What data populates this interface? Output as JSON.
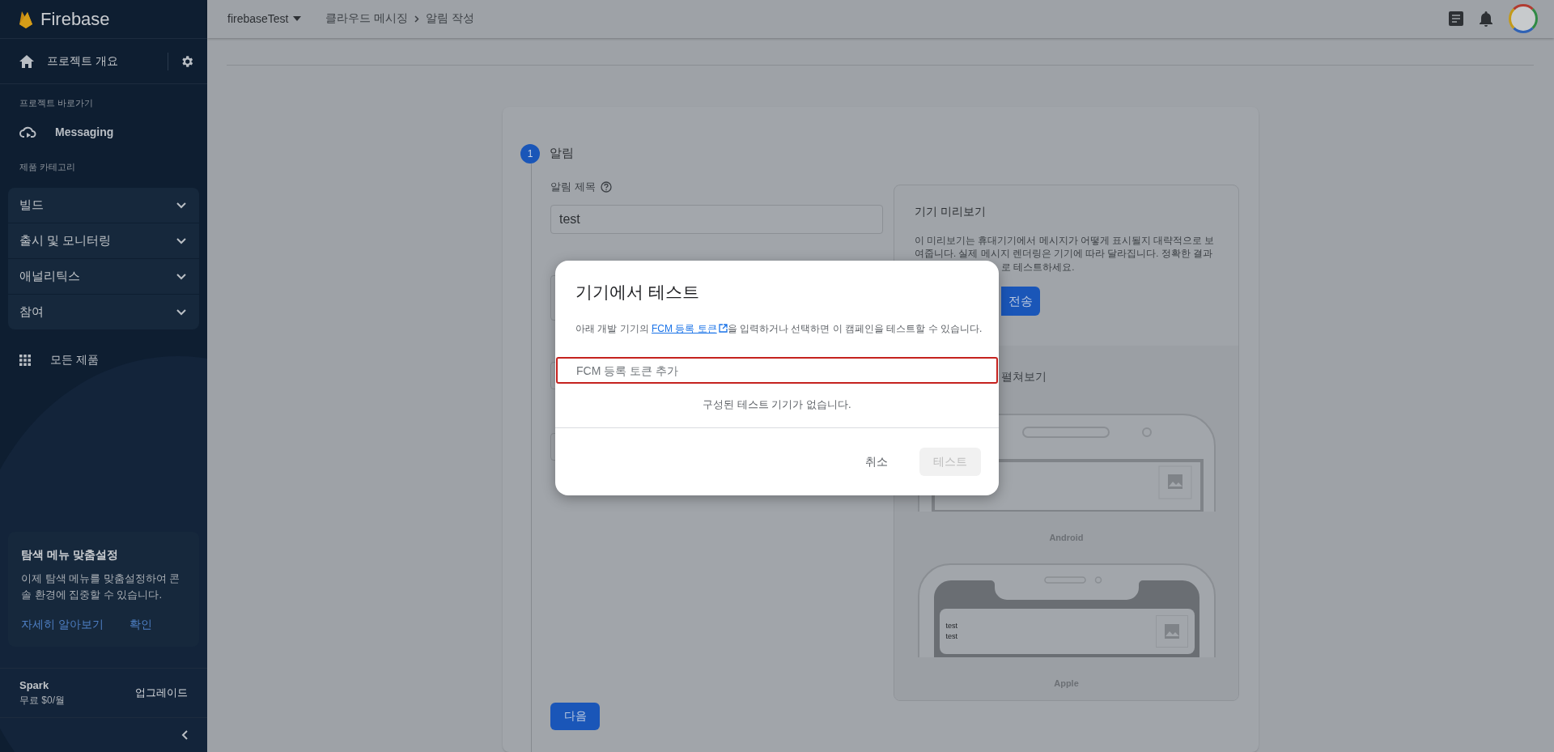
{
  "sidebar": {
    "brand": "Firebase",
    "project_overview": "프로젝트 개요",
    "shortcuts_label": "프로젝트 바로가기",
    "shortcuts": [
      {
        "label": "Messaging"
      }
    ],
    "categories_label": "제품 카테고리",
    "categories": [
      {
        "label": "빌드",
        "expanded": false
      },
      {
        "label": "출시 및 모니터링",
        "expanded": false
      },
      {
        "label": "애널리틱스",
        "expanded": false
      },
      {
        "label": "참여",
        "expanded": false
      }
    ],
    "all_products": "모든 제품",
    "customize_card": {
      "title": "탐색 메뉴 맞춤설정",
      "text": "이제 탐색 메뉴를 맞춤설정하여 콘솔 환경에 집중할 수 있습니다.",
      "links": [
        "자세히 알아보기",
        "확인"
      ]
    },
    "plan": {
      "name": "Spark",
      "price": "무료 $0/월",
      "upgrade": "업그레이드"
    }
  },
  "top_bar": {
    "project": "firebaseTest",
    "breadcrumbs": [
      "클라우드 메시징",
      "알림 작성"
    ]
  },
  "form": {
    "step": {
      "number": "1",
      "title": "알림"
    },
    "title_field": {
      "label": "알림 제목",
      "value": "test"
    },
    "next_button": "다음"
  },
  "preview": {
    "title": "기기 미리보기",
    "description_lines": [
      "이 미리보기는 휴대기기에서 메시지가 어떻게 표시될지 대략적으로 보",
      "여줍니다. 실제 메시지 렌더링은 기기에 따라 달라집니다. 정확한 결과",
      "로 테스트하세요."
    ],
    "send_button": "전송",
    "section_title": "펼쳐보기",
    "devices": [
      {
        "kind": "android",
        "label": "Android"
      },
      {
        "kind": "apple",
        "label": "Apple",
        "notification": [
          "test",
          "test"
        ]
      }
    ]
  },
  "dialog": {
    "title": "기기에서 테스트",
    "description": {
      "before": "아래 개발 기기의 ",
      "link": "FCM 등록 토큰",
      "after": "을 입력하거나 선택하면 이 캠페인을 테스트할 수 있습니다."
    },
    "token_field": {
      "placeholder": "FCM 등록 토큰 추가",
      "focused": true
    },
    "empty_text": "구성된 테스트 기기가 없습니다.",
    "buttons": [
      {
        "label": "취소",
        "disabled": false
      },
      {
        "label": "테스트",
        "disabled": true
      }
    ]
  }
}
